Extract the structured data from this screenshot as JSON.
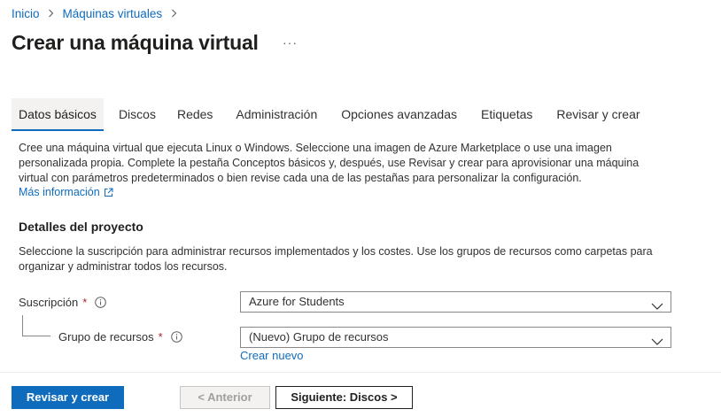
{
  "breadcrumb": {
    "items": [
      "Inicio",
      "Máquinas virtuales"
    ],
    "separator": ">"
  },
  "page": {
    "title": "Crear una máquina virtual",
    "more": "···"
  },
  "tabs": [
    {
      "label": "Datos básicos",
      "active": true
    },
    {
      "label": "Discos",
      "active": false
    },
    {
      "label": "Redes",
      "active": false
    },
    {
      "label": "Administración",
      "active": false
    },
    {
      "label": "Opciones avanzadas",
      "active": false
    },
    {
      "label": "Etiquetas",
      "active": false
    },
    {
      "label": "Revisar y crear",
      "active": false
    }
  ],
  "intro": {
    "text": "Cree una máquina virtual que ejecuta Linux o Windows. Seleccione una imagen de Azure Marketplace o use una imagen personalizada propia. Complete la pestaña Conceptos básicos y, después, use Revisar y crear para aprovisionar una máquina virtual con parámetros predeterminados o bien revise cada una de las pestañas para personalizar la configuración.",
    "learn_more": "Más información"
  },
  "project": {
    "title": "Detalles del proyecto",
    "description": "Seleccione la suscripción para administrar recursos implementados y los costes. Use los grupos de recursos como carpetas para organizar y administrar todos los recursos.",
    "subscription": {
      "label": "Suscripción",
      "required": "*",
      "value": "Azure for Students"
    },
    "resource_group": {
      "label": "Grupo de recursos",
      "required": "*",
      "value": "(Nuevo) Grupo de recursos",
      "create_new": "Crear nuevo"
    }
  },
  "footer": {
    "review_create": "Revisar y crear",
    "previous": "< Anterior",
    "next": "Siguiente: Discos >"
  },
  "colors": {
    "accent": "#0f6cbd",
    "required": "#a4262c",
    "text": "#323130"
  }
}
